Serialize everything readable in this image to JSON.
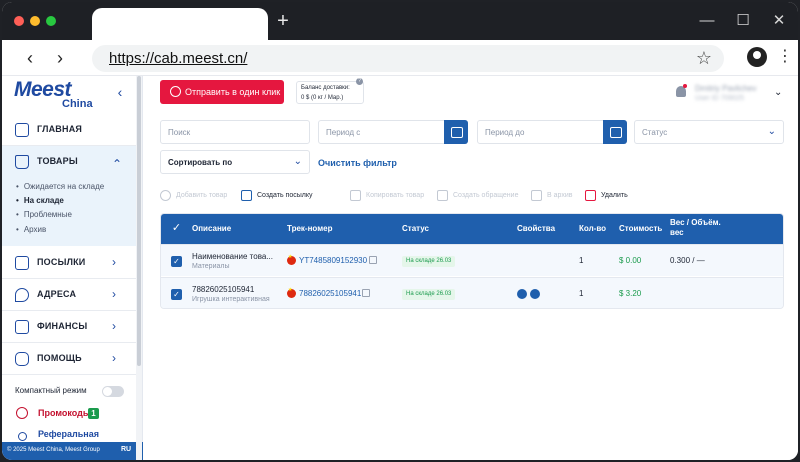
{
  "browser": {
    "url": "https://cab.meest.cn/",
    "new_tab": "+",
    "back": "‹",
    "forward": "›",
    "star": "☆",
    "menu": "⋮",
    "minimize": "—",
    "maximize": "☐",
    "close": "✕"
  },
  "sidebar": {
    "logo_main": "Meest",
    "logo_sub": "China",
    "collapse": "‹",
    "items": [
      {
        "label": "ГЛАВНАЯ",
        "icon": "grid-icon"
      },
      {
        "label": "ТОВАРЫ",
        "icon": "bag-icon",
        "chevron": "⌃"
      },
      {
        "label": "ПОСЫЛКИ",
        "icon": "package-icon",
        "chevron": "›"
      },
      {
        "label": "АДРЕСА",
        "icon": "location-pin-icon",
        "chevron": "›"
      },
      {
        "label": "ФИНАНСЫ",
        "icon": "wallet-icon",
        "chevron": "›"
      },
      {
        "label": "ПОМОЩЬ",
        "icon": "chat-icon",
        "chevron": "›"
      }
    ],
    "subitems": [
      "Ожидается на складе",
      "На складе",
      "Проблемные",
      "Архив"
    ],
    "compact_mode": "Компактный режим",
    "promo": "Промокоды",
    "promo_count": "1",
    "referral": "Реферальная",
    "footer": "© 2025 Meest China, Meest Group",
    "lang": "RU"
  },
  "header": {
    "send_button": "Отправить в один клик",
    "balance_title": "Баланс доставки:",
    "balance_value": "0 $ (0 кг / Мар.)",
    "balance_help": "?",
    "user_name": "Dmitriy Pavlichev",
    "user_id": "User ID 709025",
    "user_chevron": "⌄"
  },
  "filters": {
    "search_placeholder": "Поиск",
    "period_from": "Период с",
    "period_to": "Период до",
    "status": "Статус",
    "sort": "Сортировать по",
    "clear": "Очистить фильтр",
    "chevron": "⌄"
  },
  "actions": [
    {
      "label": "Добавить товар",
      "enabled": false
    },
    {
      "label": "Создать посылку",
      "enabled": true
    },
    {
      "label": "Копировать товар",
      "enabled": false
    },
    {
      "label": "Создать обращение",
      "enabled": false
    },
    {
      "label": "В архив",
      "enabled": false
    },
    {
      "label": "Удалить",
      "enabled": true
    }
  ],
  "table": {
    "check": "✓",
    "columns": [
      "Описание",
      "Трек-номер",
      "Статус",
      "Свойства",
      "Кол-во",
      "Стоимость",
      "Вес / Объём. вес"
    ],
    "rows": [
      {
        "name": "Наименование това...",
        "category": "Материалы",
        "track": "YT7485809152930",
        "status": "На складе 26.03",
        "qty": "1",
        "price": "$ 0.00",
        "weight": "0.300 / —"
      },
      {
        "name": "78826025105941",
        "category": "Игрушка интерактивная",
        "track": "78826025105941",
        "status": "На складе 26.03",
        "qty": "1",
        "price": "$ 3.20",
        "weight": ""
      }
    ]
  },
  "colors": {
    "brand_blue": "#1f5fad",
    "accent_red": "#e5173f",
    "status_green": "#1b9b4d"
  }
}
